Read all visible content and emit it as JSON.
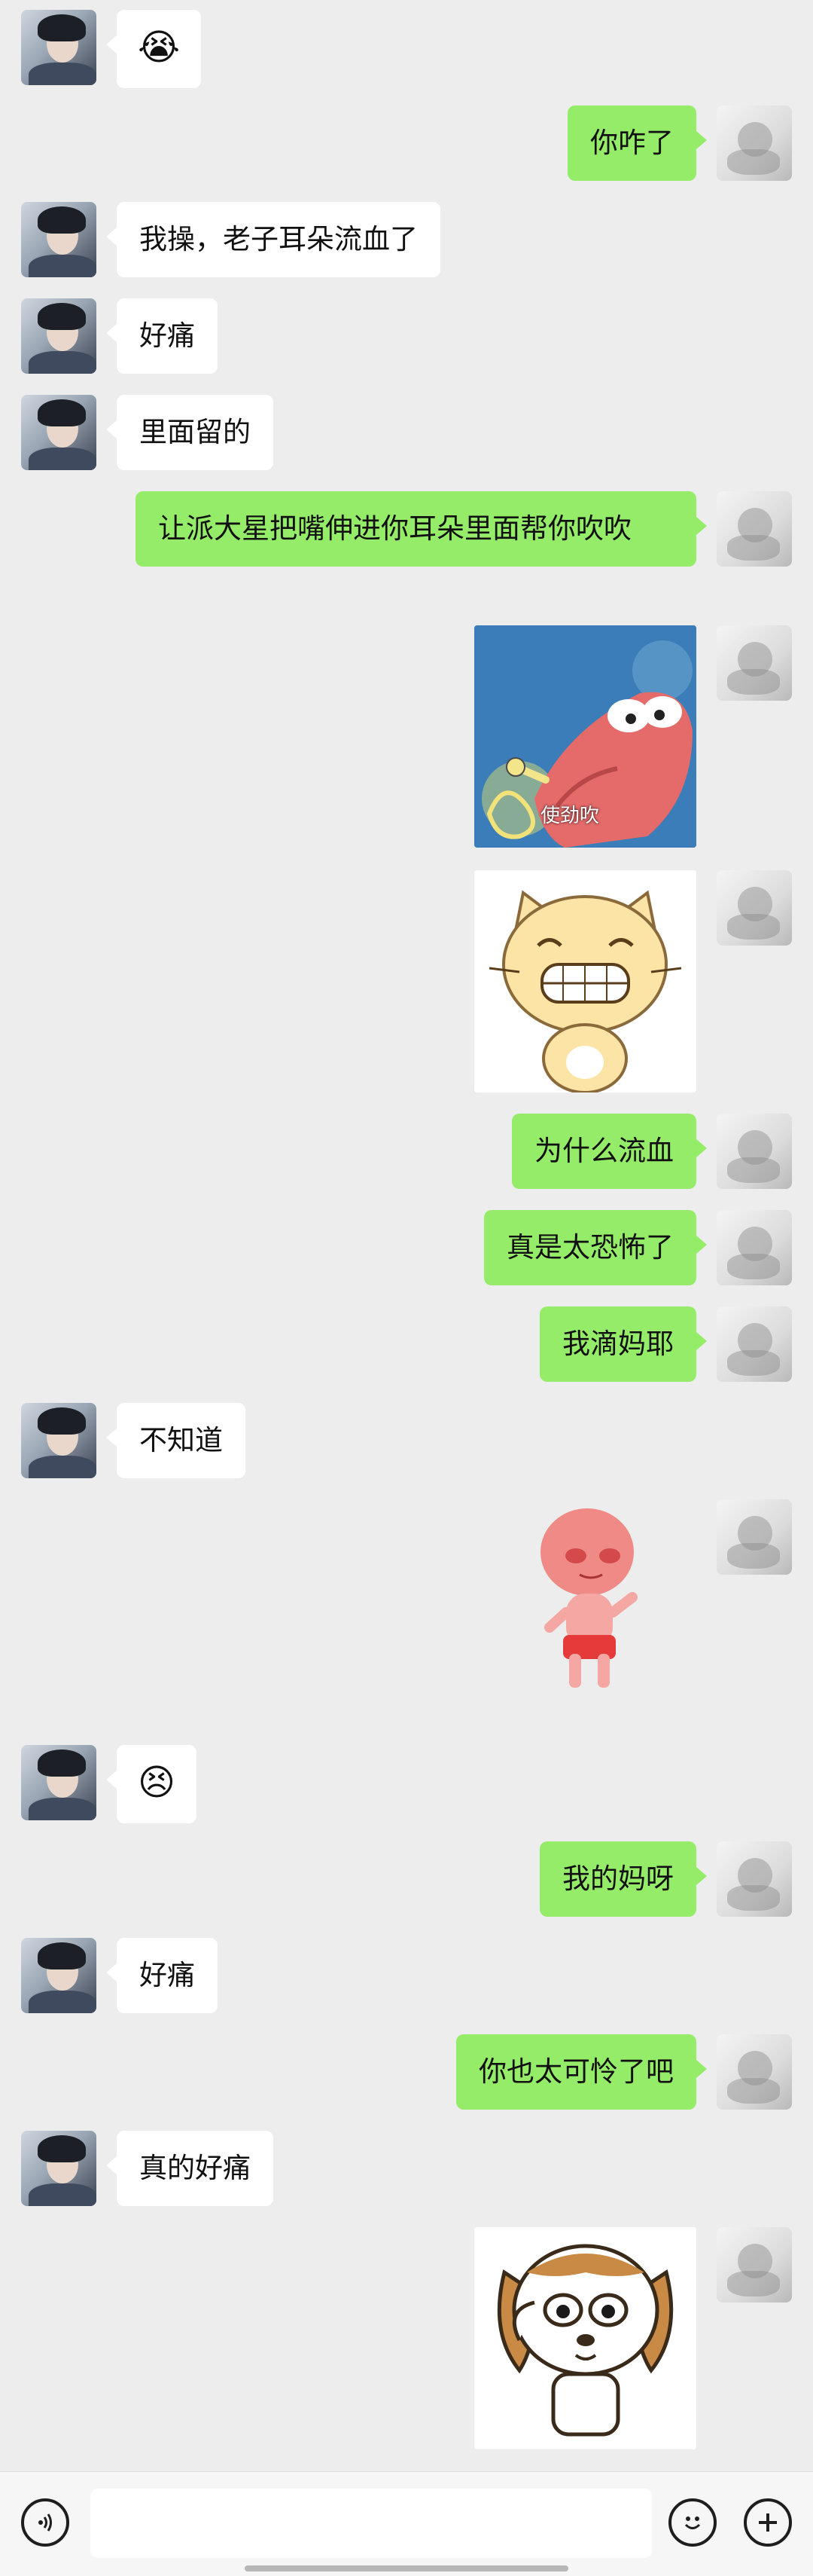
{
  "messages": [
    {
      "side": "left",
      "type": "emoji",
      "text": "😭"
    },
    {
      "side": "right",
      "type": "text",
      "text": "你咋了"
    },
    {
      "side": "left",
      "type": "text",
      "text": "我操，老子耳朵流血了"
    },
    {
      "side": "left",
      "type": "text",
      "text": "好痛"
    },
    {
      "side": "left",
      "type": "text",
      "text": "里面留的"
    },
    {
      "side": "right",
      "type": "text",
      "text": "让派大星把嘴伸进你耳朵里面帮你吹吹"
    },
    {
      "side": "right",
      "type": "sticker",
      "sticker": "patrick",
      "caption": "使劲吹"
    },
    {
      "side": "right",
      "type": "sticker",
      "sticker": "cat"
    },
    {
      "side": "right",
      "type": "text",
      "text": "为什么流血"
    },
    {
      "side": "right",
      "type": "text",
      "text": "真是太恐怖了"
    },
    {
      "side": "right",
      "type": "text",
      "text": "我滴妈耶"
    },
    {
      "side": "left",
      "type": "text",
      "text": "不知道"
    },
    {
      "side": "right",
      "type": "sticker",
      "sticker": "pink-character"
    },
    {
      "side": "left",
      "type": "emoji",
      "text": "😣"
    },
    {
      "side": "right",
      "type": "text",
      "text": "我的妈呀"
    },
    {
      "side": "left",
      "type": "text",
      "text": "好痛"
    },
    {
      "side": "right",
      "type": "text",
      "text": "你也太可怜了吧"
    },
    {
      "side": "left",
      "type": "text",
      "text": "真的好痛"
    },
    {
      "side": "right",
      "type": "sticker",
      "sticker": "dog"
    }
  ],
  "input_bar": {
    "voice_icon": "voice-icon",
    "emoji_icon": "emoji-icon",
    "plus_icon": "plus-icon",
    "text_value": ""
  },
  "colors": {
    "background": "#ededed",
    "bubble_right": "#95ec69",
    "bubble_left": "#ffffff"
  }
}
